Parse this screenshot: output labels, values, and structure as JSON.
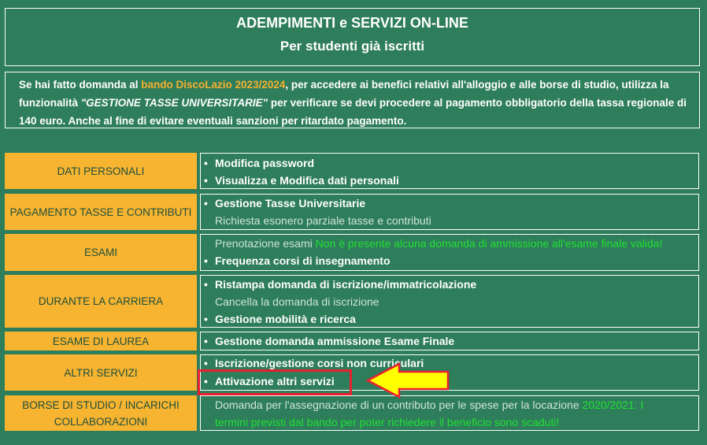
{
  "header": {
    "title": "ADEMPIMENTI e SERVIZI ON-LINE",
    "subtitle": "Per studenti già iscritti"
  },
  "notice": {
    "text_a": "Se hai fatto domanda al ",
    "link": "bando DiscoLazio 2023/2024",
    "text_b": ", per accedere ai benefici relativi all'alloggio e alle borse di studio, utilizza la funzionalità ",
    "feature": "\"GESTIONE TASSE UNIVERSITARIE\"",
    "text_c": " per verificare se devi procedere al pagamento obbligatorio della tassa regionale di 140 euro. Anche al fine di evitare eventuali sanzioni per ritardato pagamento."
  },
  "sections": {
    "dati": {
      "label": "DATI PERSONALI",
      "items": [
        "Modifica password",
        "Visualizza e Modifica dati personali"
      ]
    },
    "tasse": {
      "label": "PAGAMENTO TASSE E CONTRIBUTI",
      "items": [
        "Gestione Tasse Universitarie",
        "Richiesta esonero parziale tasse e contributi"
      ]
    },
    "esami": {
      "label": "ESAMI",
      "item1": "Prenotazione esami",
      "item1_note": "Non è presente alcuna domanda di ammissione all'esame finale valida!",
      "item2": "Frequenza corsi di insegnamento"
    },
    "carriera": {
      "label": "DURANTE LA CARRIERA",
      "items": [
        "Ristampa domanda di iscrizione/immatricolazione",
        "Cancella la domanda di iscrizione",
        "Gestione mobilità e ricerca"
      ]
    },
    "laurea": {
      "label": "ESAME DI LAUREA",
      "items": [
        "Gestione domanda ammissione Esame Finale"
      ]
    },
    "altri": {
      "label": "ALTRI SERVIZI",
      "items": [
        "Iscrizione/gestione corsi non curriculari",
        "Attivazione altri servizi"
      ]
    },
    "borse": {
      "label_l1": "BORSE DI STUDIO / INCARICHI",
      "label_l2": "COLLABORAZIONI",
      "text": "Domanda per l'assegnazione di un contributo per le spese per la locazione",
      "note_l1": "2020/2021: I",
      "note_l2": "termini previsti dal bando per poter richiedere il beneficio sono scaduti!"
    }
  },
  "colors": {
    "background": "#2e7d5b",
    "category": "#f7b431",
    "highlight_border": "#e8202f",
    "arrow": "#ffff00",
    "note_green": "#22e033"
  }
}
